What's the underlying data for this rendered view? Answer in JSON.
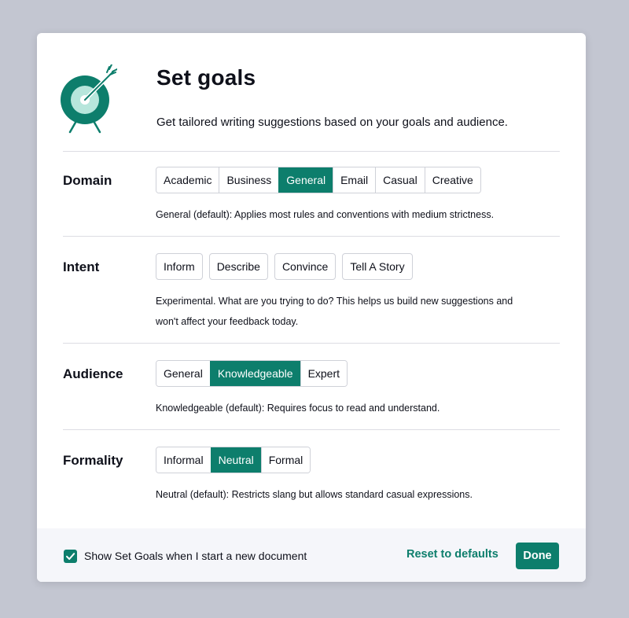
{
  "header": {
    "icon": "target-arrow-icon",
    "title": "Set goals",
    "subtitle": "Get tailored writing suggestions based on your goals and audience."
  },
  "domain": {
    "label": "Domain",
    "options": [
      "Academic",
      "Business",
      "General",
      "Email",
      "Casual",
      "Creative"
    ],
    "selected": "General",
    "description": "General (default): Applies most rules and conventions with medium strictness."
  },
  "intent": {
    "label": "Intent",
    "options": [
      "Inform",
      "Describe",
      "Convince",
      "Tell A Story"
    ],
    "description_line1": "Experimental. What are you trying to do? This helps us build new suggestions and",
    "description_line2": "won't affect your feedback today."
  },
  "audience": {
    "label": "Audience",
    "options": [
      "General",
      "Knowledgeable",
      "Expert"
    ],
    "selected": "Knowledgeable",
    "description": "Knowledgeable (default): Requires focus to read and understand."
  },
  "formality": {
    "label": "Formality",
    "options": [
      "Informal",
      "Neutral",
      "Formal"
    ],
    "selected": "Neutral",
    "description": "Neutral (default): Restricts slang but allows standard casual expressions."
  },
  "footer": {
    "show_checkbox_checked": true,
    "show_label": "Show Set Goals when I start a new document",
    "reset_label": "Reset to defaults",
    "done_label": "Done"
  },
  "colors": {
    "accent": "#0d7e6c",
    "accent_light": "#b7e6dc",
    "background": "#c3c6d1",
    "footer_bg": "#f5f6fa"
  }
}
